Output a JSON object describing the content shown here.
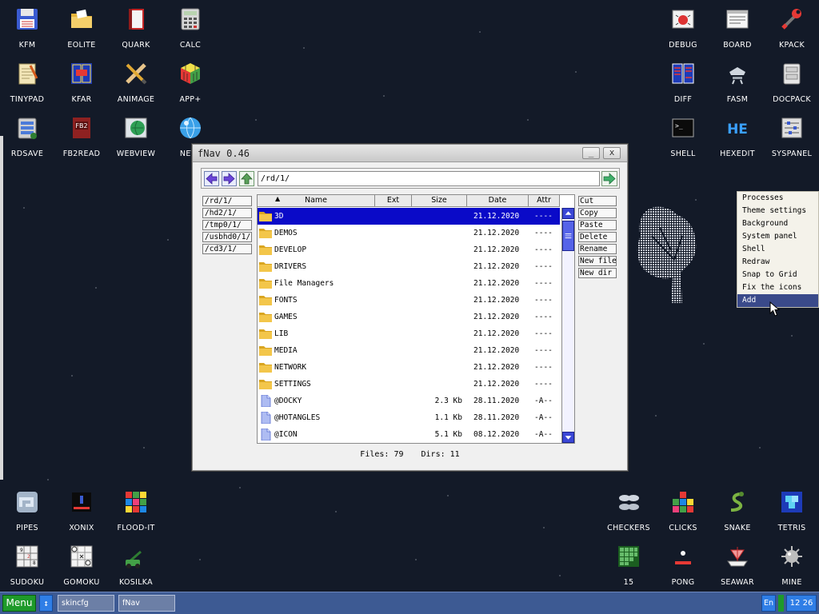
{
  "desktop": {
    "icons": [
      {
        "label": "KFM",
        "icon": "floppy-icon"
      },
      {
        "label": "EOLITE",
        "icon": "folder-icon"
      },
      {
        "label": "QUARK",
        "icon": "book-icon"
      },
      {
        "label": "CALC",
        "icon": "calculator-icon"
      },
      {
        "label": "TINYPAD",
        "icon": "notepad-icon"
      },
      {
        "label": "KFAR",
        "icon": "kfar-icon"
      },
      {
        "label": "ANIMAGE",
        "icon": "pencil-ruler-icon"
      },
      {
        "label": "APP+",
        "icon": "rubik-cube-icon"
      },
      {
        "label": "RDSAVE",
        "icon": "rdsave-icon"
      },
      {
        "label": "FB2READ",
        "icon": "fb2-book-icon"
      },
      {
        "label": "WEBVIEW",
        "icon": "webview-icon"
      },
      {
        "label": "NETS",
        "icon": "globe-icon"
      },
      {
        "label": "DEBUG",
        "icon": "bug-icon"
      },
      {
        "label": "BOARD",
        "icon": "board-icon"
      },
      {
        "label": "KPACK",
        "icon": "wrench-icon"
      },
      {
        "label": "DIFF",
        "icon": "diff-icon"
      },
      {
        "label": "FASM",
        "icon": "fasm-icon"
      },
      {
        "label": "DOCPACK",
        "icon": "docpack-icon"
      },
      {
        "label": "SHELL",
        "icon": "terminal-icon"
      },
      {
        "label": "HEXEDIT",
        "icon": "hexedit-icon"
      },
      {
        "label": "SYSPANEL",
        "icon": "sliders-icon"
      },
      {
        "label": "PIPES",
        "icon": "pipes-icon"
      },
      {
        "label": "XONIX",
        "icon": "xonix-icon"
      },
      {
        "label": "FLOOD-IT",
        "icon": "flood-it-icon"
      },
      {
        "label": "SUDOKU",
        "icon": "sudoku-icon"
      },
      {
        "label": "GOMOKU",
        "icon": "gomoku-icon"
      },
      {
        "label": "KOSILKA",
        "icon": "lawnmower-icon"
      },
      {
        "label": "CHECKERS",
        "icon": "checkers-icon"
      },
      {
        "label": "CLICKS",
        "icon": "clicks-icon"
      },
      {
        "label": "SNAKE",
        "icon": "snake-icon"
      },
      {
        "label": "TETRIS",
        "icon": "tetris-icon"
      },
      {
        "label": "15",
        "icon": "fifteen-puzzle-icon"
      },
      {
        "label": "PONG",
        "icon": "pong-icon"
      },
      {
        "label": "SEAWAR",
        "icon": "ship-icon"
      },
      {
        "label": "MINE",
        "icon": "mine-icon"
      }
    ]
  },
  "window": {
    "title": "fNav 0.46",
    "minimize": "_",
    "close": "x",
    "path": "/rd/1/",
    "drives": [
      "/rd/1/",
      "/hd2/1/",
      "/tmp0/1/",
      "/usbhd0/1/",
      "/cd3/1/"
    ],
    "columns": {
      "name": "Name",
      "ext": "Ext",
      "size": "Size",
      "date": "Date",
      "attr": "Attr"
    },
    "files": [
      {
        "name": "3D",
        "ext": "",
        "size": "",
        "date": "21.12.2020",
        "attr": "----",
        "type": "folder",
        "selected": true
      },
      {
        "name": "DEMOS",
        "ext": "",
        "size": "",
        "date": "21.12.2020",
        "attr": "----",
        "type": "folder"
      },
      {
        "name": "DEVELOP",
        "ext": "",
        "size": "",
        "date": "21.12.2020",
        "attr": "----",
        "type": "folder"
      },
      {
        "name": "DRIVERS",
        "ext": "",
        "size": "",
        "date": "21.12.2020",
        "attr": "----",
        "type": "folder"
      },
      {
        "name": "File Managers",
        "ext": "",
        "size": "",
        "date": "21.12.2020",
        "attr": "----",
        "type": "folder"
      },
      {
        "name": "FONTS",
        "ext": "",
        "size": "",
        "date": "21.12.2020",
        "attr": "----",
        "type": "folder"
      },
      {
        "name": "GAMES",
        "ext": "",
        "size": "",
        "date": "21.12.2020",
        "attr": "----",
        "type": "folder"
      },
      {
        "name": "LIB",
        "ext": "",
        "size": "",
        "date": "21.12.2020",
        "attr": "----",
        "type": "folder"
      },
      {
        "name": "MEDIA",
        "ext": "",
        "size": "",
        "date": "21.12.2020",
        "attr": "----",
        "type": "folder"
      },
      {
        "name": "NETWORK",
        "ext": "",
        "size": "",
        "date": "21.12.2020",
        "attr": "----",
        "type": "folder"
      },
      {
        "name": "SETTINGS",
        "ext": "",
        "size": "",
        "date": "21.12.2020",
        "attr": "----",
        "type": "folder"
      },
      {
        "name": "@DOCKY",
        "ext": "",
        "size": "2.3 Kb",
        "date": "28.11.2020",
        "attr": "-A--",
        "type": "file"
      },
      {
        "name": "@HOTANGLES",
        "ext": "",
        "size": "1.1 Kb",
        "date": "28.11.2020",
        "attr": "-A--",
        "type": "file"
      },
      {
        "name": "@ICON",
        "ext": "",
        "size": "5.1 Kb",
        "date": "08.12.2020",
        "attr": "-A--",
        "type": "file"
      }
    ],
    "actions": [
      "Cut",
      "Copy",
      "Paste",
      "Delete",
      "Rename",
      "New file",
      "New dir"
    ],
    "status": {
      "files": "Files: 79",
      "dirs": "Dirs: 11"
    }
  },
  "context_menu": {
    "items": [
      "Processes",
      "Theme settings",
      "Background",
      "System panel",
      "Shell",
      "Redraw",
      "Snap to Grid",
      "Fix the icons",
      "Add"
    ],
    "active_index": 8
  },
  "taskbar": {
    "menu": "Menu",
    "switch": "↕",
    "tasks": [
      "skincfg",
      "fNav"
    ],
    "lang": "En",
    "clock": "12 26"
  },
  "colors": {
    "desktop_bg": "#131a28",
    "selection": "#0a0ac8",
    "taskbar": "#3d5a93",
    "menu_button": "#1e9a2a",
    "accent_blue": "#2f7ee6"
  }
}
